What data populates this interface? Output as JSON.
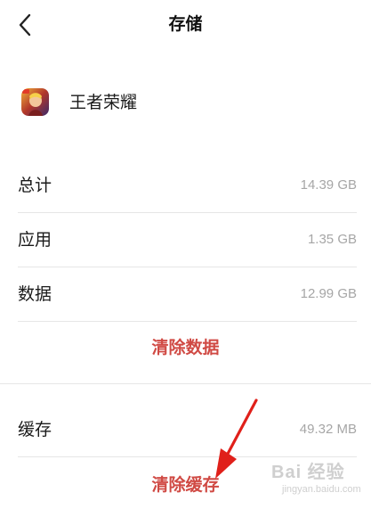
{
  "header": {
    "title": "存储"
  },
  "app": {
    "name": "王者荣耀"
  },
  "storage": {
    "total": {
      "label": "总计",
      "value": "14.39 GB"
    },
    "apps": {
      "label": "应用",
      "value": "1.35 GB"
    },
    "data": {
      "label": "数据",
      "value": "12.99 GB"
    },
    "clear_data_label": "清除数据",
    "cache": {
      "label": "缓存",
      "value": "49.32 MB"
    },
    "clear_cache_label": "清除缓存"
  },
  "colors": {
    "accent": "#d9534f",
    "arrow": "#e0201a",
    "muted_text": "#a6a6a6"
  },
  "watermark": {
    "logo_text": "Bai 经验",
    "sub_text": "jingyan.baidu.com"
  }
}
